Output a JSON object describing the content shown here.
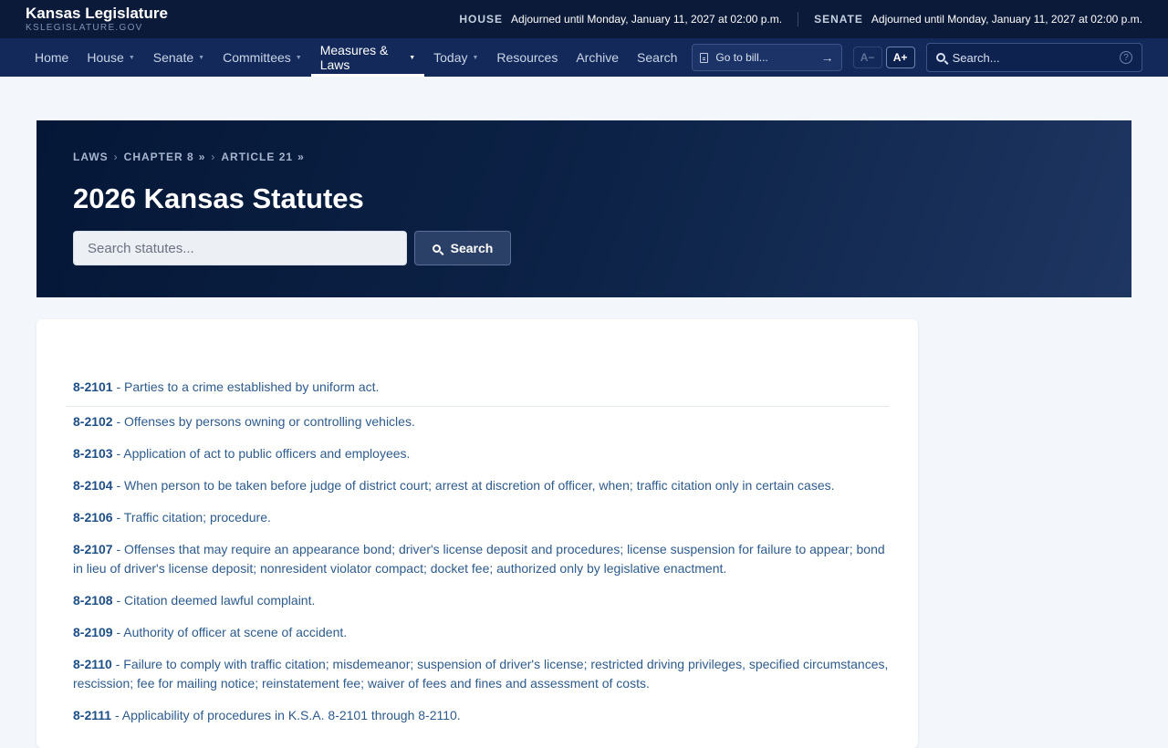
{
  "brand": {
    "title": "Kansas Legislature",
    "subtitle": "KSLEGISLATURE.GOV"
  },
  "status": {
    "house_label": "HOUSE",
    "house_text": "Adjourned until Monday, January 11, 2027 at 02:00 p.m.",
    "senate_label": "SENATE",
    "senate_text": "Adjourned until Monday, January 11, 2027 at 02:00 p.m."
  },
  "nav": {
    "items": [
      {
        "label": "Home",
        "dropdown": false
      },
      {
        "label": "House",
        "dropdown": true
      },
      {
        "label": "Senate",
        "dropdown": true
      },
      {
        "label": "Committees",
        "dropdown": true
      },
      {
        "label": "Measures & Laws",
        "dropdown": true,
        "active": true
      },
      {
        "label": "Today",
        "dropdown": true
      },
      {
        "label": "Resources",
        "dropdown": false
      },
      {
        "label": "Archive",
        "dropdown": false
      },
      {
        "label": "Search",
        "dropdown": false
      }
    ],
    "caret": "▼",
    "go_to_bill": "Go to bill...",
    "go_arrow": "→",
    "font_minus": "A−",
    "font_plus": "A+",
    "search_placeholder": "Search...",
    "help": "?"
  },
  "hero": {
    "breadcrumbs": [
      {
        "label": "LAWS",
        "trail": ""
      },
      {
        "label": "CHAPTER 8",
        "trail": "»"
      },
      {
        "label": "ARTICLE 21",
        "trail": "»"
      }
    ],
    "crumb_sep": "›",
    "title": "2026 Kansas Statutes",
    "search_placeholder": "Search statutes...",
    "search_button": "Search"
  },
  "statutes": [
    {
      "number": "8-2101",
      "title": "Parties to a crime established by uniform act."
    },
    {
      "number": "8-2102",
      "title": "Offenses by persons owning or controlling vehicles."
    },
    {
      "number": "8-2103",
      "title": "Application of act to public officers and employees."
    },
    {
      "number": "8-2104",
      "title": "When person to be taken before judge of district court; arrest at discretion of officer, when; traffic citation only in certain cases."
    },
    {
      "number": "8-2106",
      "title": "Traffic citation; procedure."
    },
    {
      "number": "8-2107",
      "title": "Offenses that may require an appearance bond; driver's license deposit and procedures; license suspension for failure to appear; bond in lieu of driver's license deposit; nonresident violator compact; docket fee; authorized only by legislative enactment."
    },
    {
      "number": "8-2108",
      "title": "Citation deemed lawful complaint."
    },
    {
      "number": "8-2109",
      "title": "Authority of officer at scene of accident."
    },
    {
      "number": "8-2110",
      "title": "Failure to comply with traffic citation; misdemeanor; suspension of driver's license; restricted driving privileges, specified circumstances, rescission; fee for mailing notice; reinstatement fee; waiver of fees and fines and assessment of costs."
    },
    {
      "number": "8-2111",
      "title": "Applicability of procedures in K.S.A. 8-2101 through 8-2110."
    }
  ],
  "statute_sep": " - "
}
